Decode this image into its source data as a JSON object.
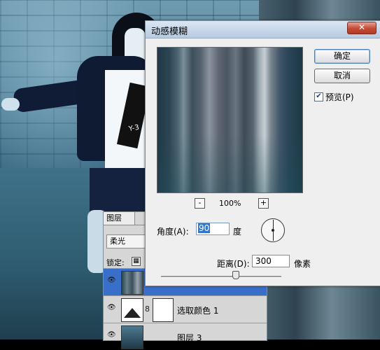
{
  "dialog": {
    "title": "动感模糊",
    "close_label": "✕",
    "ok_label": "确定",
    "cancel_label": "取消",
    "preview_label": "预览(P)",
    "preview_checked": true,
    "zoom_out_label": "-",
    "zoom_in_label": "+",
    "zoom_level": "100%",
    "angle_label": "角度(A):",
    "angle_value": "90",
    "angle_unit": "度",
    "distance_label": "距离(D):",
    "distance_value": "300",
    "distance_unit": "像素"
  },
  "layers_panel": {
    "tab_label": "图层",
    "blend_mode": "柔光",
    "lock_label": "锁定:",
    "layers": [
      {
        "name": "",
        "thumb": "blur",
        "active": true
      },
      {
        "name": "选取颜色 1",
        "thumb": "adjustment",
        "active": false
      },
      {
        "name": "图层 3",
        "thumb": "photo",
        "active": false
      }
    ]
  },
  "photo": {
    "shirt_text": "Y-3"
  },
  "colors": {
    "titlebar": "#c9d8ea",
    "active_layer": "#3a6fc9",
    "close_button": "#c24a34"
  }
}
